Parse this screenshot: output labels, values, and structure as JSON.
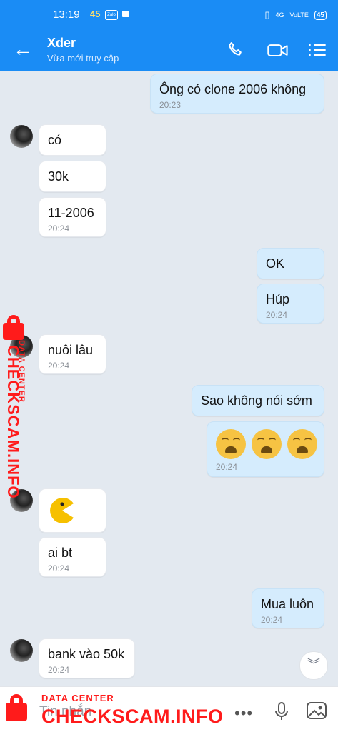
{
  "status_bar": {
    "time": "13:19",
    "notif_count": "45",
    "zalo_icon_text": "Zalo",
    "network": "4G",
    "volte": "VoLTE",
    "battery": "45"
  },
  "header": {
    "contact_name": "Xder",
    "status": "Vừa mới truy cập"
  },
  "messages": [
    {
      "side": "out",
      "text": "Ông có clone 2006 không",
      "time": "20:23"
    },
    {
      "side": "in",
      "text": "có"
    },
    {
      "side": "in",
      "text": "30k"
    },
    {
      "side": "in",
      "text": "11-2006",
      "time": "20:24"
    },
    {
      "side": "out",
      "text": "OK"
    },
    {
      "side": "out",
      "text": "Húp",
      "time": "20:24"
    },
    {
      "side": "in",
      "text": "nuôi lâu",
      "time": "20:24"
    },
    {
      "side": "out",
      "text": "Sao không nói sớm"
    },
    {
      "side": "out",
      "emoji": "weary-face x3",
      "time": "20:24"
    },
    {
      "side": "in",
      "emoji": "pacman-sticker"
    },
    {
      "side": "in",
      "text": "ai bt",
      "time": "20:24"
    },
    {
      "side": "out",
      "text": "Mua luôn",
      "time": "20:24"
    },
    {
      "side": "in",
      "text": "bank vào 50k",
      "time": "20:24"
    }
  ],
  "input": {
    "placeholder": "Tin nhắn"
  },
  "watermark": {
    "label": "DATA CENTER",
    "site": "CHECKSCAM.INFO",
    "color": "#ff1b1b"
  },
  "colors": {
    "header": "#1a8cf5",
    "out_bubble": "#d5ecfd",
    "background": "#e3e9f0"
  }
}
